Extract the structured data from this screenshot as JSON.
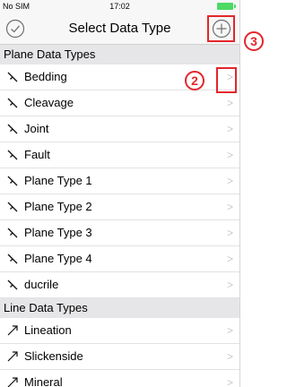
{
  "status_bar": {
    "carrier": "No SIM",
    "time": "17:02"
  },
  "navbar": {
    "title": "Select Data Type",
    "done_icon": "check-circle-icon",
    "add_icon": "plus-circle-icon"
  },
  "sections": [
    {
      "header": "Plane Data Types",
      "rows": [
        {
          "label": "Bedding",
          "icon": "plane-symbol-icon"
        },
        {
          "label": "Cleavage",
          "icon": "plane-symbol-icon"
        },
        {
          "label": "Joint",
          "icon": "plane-symbol-icon"
        },
        {
          "label": "Fault",
          "icon": "plane-symbol-icon"
        },
        {
          "label": "Plane Type 1",
          "icon": "plane-symbol-icon"
        },
        {
          "label": "Plane Type 2",
          "icon": "plane-symbol-icon"
        },
        {
          "label": "Plane Type 3",
          "icon": "plane-symbol-icon"
        },
        {
          "label": "Plane Type 4",
          "icon": "plane-symbol-icon"
        },
        {
          "label": "ducrile",
          "icon": "plane-symbol-icon"
        }
      ]
    },
    {
      "header": "Line Data Types",
      "rows": [
        {
          "label": "Lineation",
          "icon": "line-arrow-icon"
        },
        {
          "label": "Slickenside",
          "icon": "line-arrow-icon"
        },
        {
          "label": "Mineral",
          "icon": "line-arrow-icon"
        }
      ]
    }
  ],
  "chevron": ">",
  "annotations": {
    "callout_2": "2",
    "callout_3": "3"
  },
  "colors": {
    "annotation": "#e3262c",
    "battery": "#4cd964",
    "section_bg": "#e6e6e8",
    "chevron": "#c7c7cc"
  }
}
